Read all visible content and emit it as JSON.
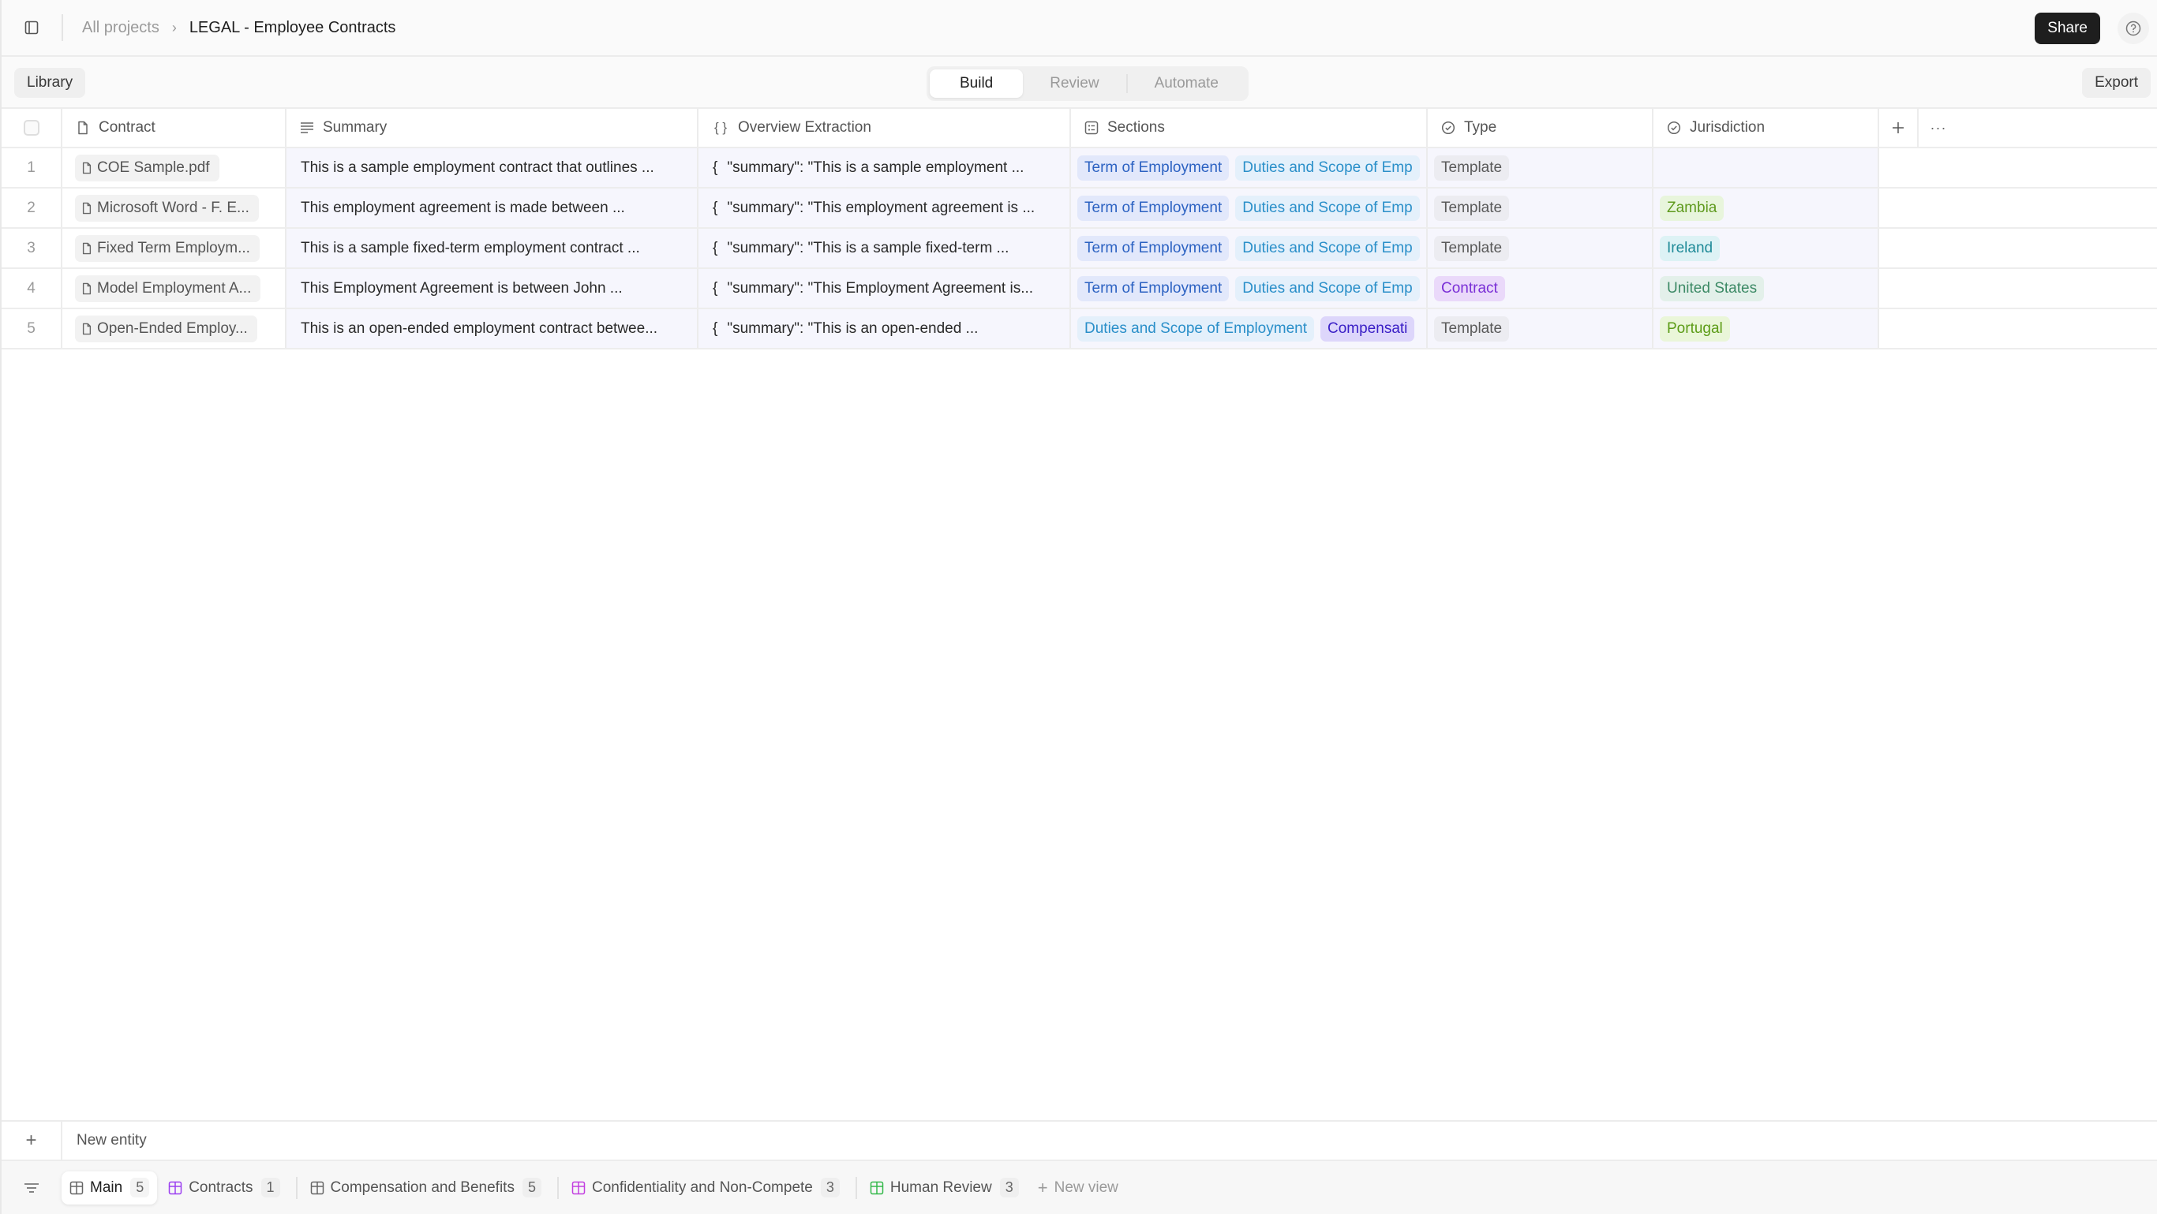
{
  "header": {
    "breadcrumb_root": "All projects",
    "breadcrumb_current": "LEGAL - Employee Contracts",
    "share_label": "Share",
    "help_icon": "question-circle-icon"
  },
  "toolbar": {
    "library_label": "Library",
    "modes": [
      {
        "label": "Build",
        "active": true
      },
      {
        "label": "Review",
        "active": false
      },
      {
        "label": "Automate",
        "active": false
      }
    ],
    "export_label": "Export"
  },
  "columns": {
    "contract": "Contract",
    "summary": "Summary",
    "overview": "Overview Extraction",
    "sections": "Sections",
    "type": "Type",
    "jurisdiction": "Jurisdiction"
  },
  "rows": [
    {
      "num": "1",
      "contract": "COE Sample.pdf",
      "summary": "This is a sample employment contract that outlines ...",
      "overview": "\"summary\": \"This is a sample employment ...",
      "sections": [
        {
          "label": "Term of Employment",
          "kind": "term"
        },
        {
          "label": "Duties and Scope of Emp",
          "kind": "duties"
        }
      ],
      "type": {
        "label": "Template",
        "kind": "tmpl"
      },
      "jurisdiction": null
    },
    {
      "num": "2",
      "contract": "Microsoft Word - F. E...",
      "summary": "This employment agreement is made between ...",
      "overview": "\"summary\": \"This employment agreement is ...",
      "sections": [
        {
          "label": "Term of Employment",
          "kind": "term"
        },
        {
          "label": "Duties and Scope of Emp",
          "kind": "duties"
        }
      ],
      "type": {
        "label": "Template",
        "kind": "tmpl"
      },
      "jurisdiction": {
        "label": "Zambia",
        "kind": "zambia"
      }
    },
    {
      "num": "3",
      "contract": "Fixed Term Employm...",
      "summary": "This is a sample fixed-term employment contract ...",
      "overview": "\"summary\": \"This is a sample fixed-term ...",
      "sections": [
        {
          "label": "Term of Employment",
          "kind": "term"
        },
        {
          "label": "Duties and Scope of Emp",
          "kind": "duties"
        }
      ],
      "type": {
        "label": "Template",
        "kind": "tmpl"
      },
      "jurisdiction": {
        "label": "Ireland",
        "kind": "ireland"
      }
    },
    {
      "num": "4",
      "contract": "Model Employment A...",
      "summary": "This Employment Agreement is between John ...",
      "overview": "\"summary\": \"This Employment Agreement is...",
      "sections": [
        {
          "label": "Term of Employment",
          "kind": "term"
        },
        {
          "label": "Duties and Scope of Emp",
          "kind": "duties"
        }
      ],
      "type": {
        "label": "Contract",
        "kind": "contract"
      },
      "jurisdiction": {
        "label": "United States",
        "kind": "us"
      }
    },
    {
      "num": "5",
      "contract": "Open-Ended Employ...",
      "summary": "This is an open-ended employment contract betwee...",
      "overview": "\"summary\": \"This is an open-ended ...",
      "sections": [
        {
          "label": "Duties and Scope of Employment",
          "kind": "duties"
        },
        {
          "label": "Compensati",
          "kind": "comp"
        }
      ],
      "type": {
        "label": "Template",
        "kind": "tmpl"
      },
      "jurisdiction": {
        "label": "Portugal",
        "kind": "portugal"
      }
    }
  ],
  "footer": {
    "new_entity_label": "New entity",
    "views": [
      {
        "label": "Main",
        "count": "5",
        "active": true,
        "color": "#666666"
      },
      {
        "label": "Contracts",
        "count": "1",
        "active": false,
        "color": "#9b3ff0"
      },
      {
        "label": "Compensation and Benefits",
        "count": "5",
        "active": false,
        "color": "#666666"
      },
      {
        "label": "Confidentiality and Non-Compete",
        "count": "3",
        "active": false,
        "color": "#c23fe0"
      },
      {
        "label": "Human Review",
        "count": "3",
        "active": false,
        "color": "#34b84a"
      }
    ],
    "new_view_label": "New view"
  }
}
